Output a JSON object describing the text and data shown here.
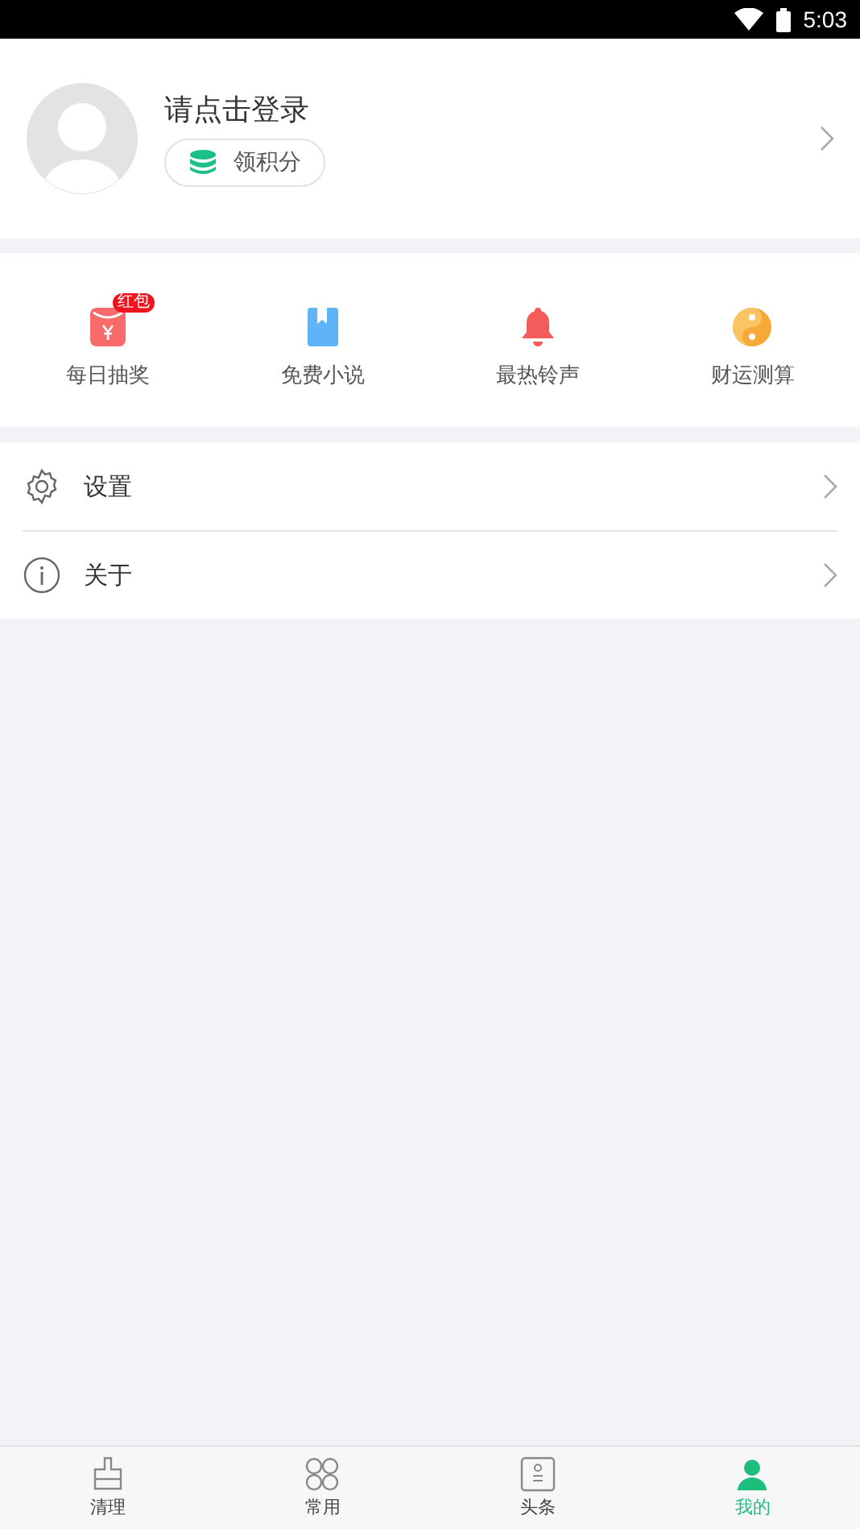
{
  "status_bar": {
    "time": "5:03"
  },
  "profile": {
    "title": "请点击登录",
    "points_button": "领积分"
  },
  "shortcuts": [
    {
      "kind": "red-packet",
      "label": "每日抽奖",
      "badge": "红包"
    },
    {
      "kind": "book",
      "label": "免费小说"
    },
    {
      "kind": "bell",
      "label": "最热铃声"
    },
    {
      "kind": "yinyang",
      "label": "财运测算"
    }
  ],
  "menu": [
    {
      "kind": "settings",
      "label": "设置"
    },
    {
      "kind": "info",
      "label": "关于"
    }
  ],
  "tab_bar": [
    {
      "kind": "clean",
      "label": "清理",
      "selected": false
    },
    {
      "kind": "grid",
      "label": "常用",
      "selected": false
    },
    {
      "kind": "news",
      "label": "头条",
      "selected": false
    },
    {
      "kind": "me",
      "label": "我的",
      "selected": true
    }
  ]
}
